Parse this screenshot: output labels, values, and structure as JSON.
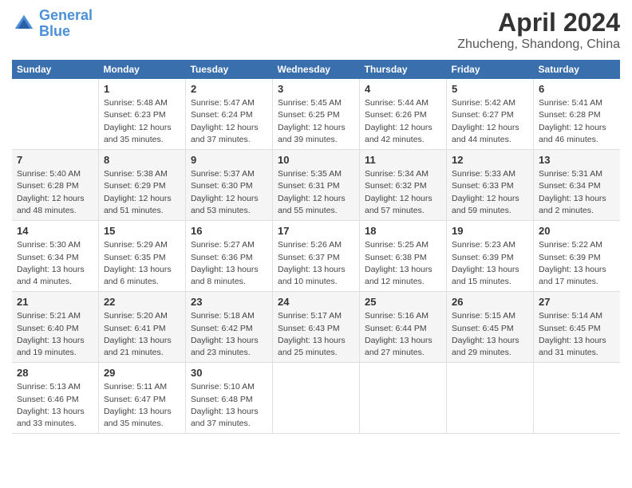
{
  "header": {
    "logo_line1": "General",
    "logo_line2": "Blue",
    "title": "April 2024",
    "subtitle": "Zhucheng, Shandong, China"
  },
  "days_of_week": [
    "Sunday",
    "Monday",
    "Tuesday",
    "Wednesday",
    "Thursday",
    "Friday",
    "Saturday"
  ],
  "weeks": [
    [
      {
        "day": "",
        "info": ""
      },
      {
        "day": "1",
        "info": "Sunrise: 5:48 AM\nSunset: 6:23 PM\nDaylight: 12 hours\nand 35 minutes."
      },
      {
        "day": "2",
        "info": "Sunrise: 5:47 AM\nSunset: 6:24 PM\nDaylight: 12 hours\nand 37 minutes."
      },
      {
        "day": "3",
        "info": "Sunrise: 5:45 AM\nSunset: 6:25 PM\nDaylight: 12 hours\nand 39 minutes."
      },
      {
        "day": "4",
        "info": "Sunrise: 5:44 AM\nSunset: 6:26 PM\nDaylight: 12 hours\nand 42 minutes."
      },
      {
        "day": "5",
        "info": "Sunrise: 5:42 AM\nSunset: 6:27 PM\nDaylight: 12 hours\nand 44 minutes."
      },
      {
        "day": "6",
        "info": "Sunrise: 5:41 AM\nSunset: 6:28 PM\nDaylight: 12 hours\nand 46 minutes."
      }
    ],
    [
      {
        "day": "7",
        "info": "Sunrise: 5:40 AM\nSunset: 6:28 PM\nDaylight: 12 hours\nand 48 minutes."
      },
      {
        "day": "8",
        "info": "Sunrise: 5:38 AM\nSunset: 6:29 PM\nDaylight: 12 hours\nand 51 minutes."
      },
      {
        "day": "9",
        "info": "Sunrise: 5:37 AM\nSunset: 6:30 PM\nDaylight: 12 hours\nand 53 minutes."
      },
      {
        "day": "10",
        "info": "Sunrise: 5:35 AM\nSunset: 6:31 PM\nDaylight: 12 hours\nand 55 minutes."
      },
      {
        "day": "11",
        "info": "Sunrise: 5:34 AM\nSunset: 6:32 PM\nDaylight: 12 hours\nand 57 minutes."
      },
      {
        "day": "12",
        "info": "Sunrise: 5:33 AM\nSunset: 6:33 PM\nDaylight: 12 hours\nand 59 minutes."
      },
      {
        "day": "13",
        "info": "Sunrise: 5:31 AM\nSunset: 6:34 PM\nDaylight: 13 hours\nand 2 minutes."
      }
    ],
    [
      {
        "day": "14",
        "info": "Sunrise: 5:30 AM\nSunset: 6:34 PM\nDaylight: 13 hours\nand 4 minutes."
      },
      {
        "day": "15",
        "info": "Sunrise: 5:29 AM\nSunset: 6:35 PM\nDaylight: 13 hours\nand 6 minutes."
      },
      {
        "day": "16",
        "info": "Sunrise: 5:27 AM\nSunset: 6:36 PM\nDaylight: 13 hours\nand 8 minutes."
      },
      {
        "day": "17",
        "info": "Sunrise: 5:26 AM\nSunset: 6:37 PM\nDaylight: 13 hours\nand 10 minutes."
      },
      {
        "day": "18",
        "info": "Sunrise: 5:25 AM\nSunset: 6:38 PM\nDaylight: 13 hours\nand 12 minutes."
      },
      {
        "day": "19",
        "info": "Sunrise: 5:23 AM\nSunset: 6:39 PM\nDaylight: 13 hours\nand 15 minutes."
      },
      {
        "day": "20",
        "info": "Sunrise: 5:22 AM\nSunset: 6:39 PM\nDaylight: 13 hours\nand 17 minutes."
      }
    ],
    [
      {
        "day": "21",
        "info": "Sunrise: 5:21 AM\nSunset: 6:40 PM\nDaylight: 13 hours\nand 19 minutes."
      },
      {
        "day": "22",
        "info": "Sunrise: 5:20 AM\nSunset: 6:41 PM\nDaylight: 13 hours\nand 21 minutes."
      },
      {
        "day": "23",
        "info": "Sunrise: 5:18 AM\nSunset: 6:42 PM\nDaylight: 13 hours\nand 23 minutes."
      },
      {
        "day": "24",
        "info": "Sunrise: 5:17 AM\nSunset: 6:43 PM\nDaylight: 13 hours\nand 25 minutes."
      },
      {
        "day": "25",
        "info": "Sunrise: 5:16 AM\nSunset: 6:44 PM\nDaylight: 13 hours\nand 27 minutes."
      },
      {
        "day": "26",
        "info": "Sunrise: 5:15 AM\nSunset: 6:45 PM\nDaylight: 13 hours\nand 29 minutes."
      },
      {
        "day": "27",
        "info": "Sunrise: 5:14 AM\nSunset: 6:45 PM\nDaylight: 13 hours\nand 31 minutes."
      }
    ],
    [
      {
        "day": "28",
        "info": "Sunrise: 5:13 AM\nSunset: 6:46 PM\nDaylight: 13 hours\nand 33 minutes."
      },
      {
        "day": "29",
        "info": "Sunrise: 5:11 AM\nSunset: 6:47 PM\nDaylight: 13 hours\nand 35 minutes."
      },
      {
        "day": "30",
        "info": "Sunrise: 5:10 AM\nSunset: 6:48 PM\nDaylight: 13 hours\nand 37 minutes."
      },
      {
        "day": "",
        "info": ""
      },
      {
        "day": "",
        "info": ""
      },
      {
        "day": "",
        "info": ""
      },
      {
        "day": "",
        "info": ""
      }
    ]
  ]
}
